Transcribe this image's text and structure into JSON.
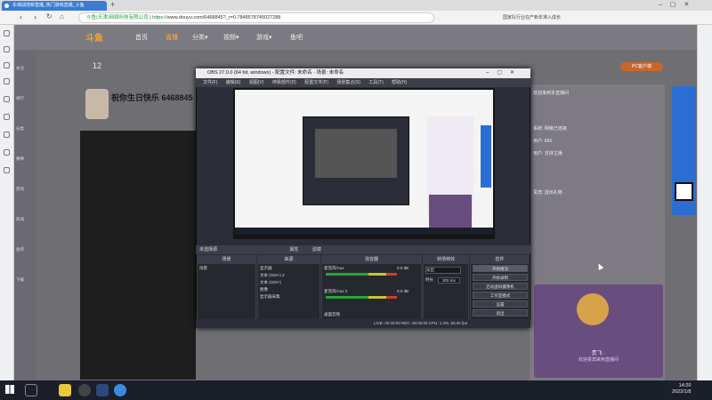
{
  "browser": {
    "tab_title": "东城战境新直播_热门游戏直播_斗鱼",
    "url_org": "斗鱼(天津)网络科技有限公司",
    "url_secure": "https://",
    "url_path": "www.douyu.com/6468845?_r=0.7848578745027288",
    "right_hint": "国家队行业在产新年准入成长"
  },
  "site": {
    "logo": "斗鱼",
    "nav": [
      "首页",
      "直播",
      "分类▾",
      "视频▾",
      "游戏▾",
      "鱼吧"
    ],
    "left_nav": [
      "关注",
      "排行",
      "分类",
      "赛事",
      "游戏",
      "商城",
      "鱼吧",
      "下载"
    ],
    "room_title": "祝你生日快乐 6468845",
    "follow_count": "12",
    "pc_download": "PC客户端"
  },
  "chat": {
    "messages": [
      "欢迎来到本直播间",
      "系统: 网络已连接",
      "用户: 666",
      "用户: 支持主播",
      "贵宾: 送出礼物"
    ],
    "gift_name": "贵飞 ·",
    "gift_sub": "欢迎贵宾来到直播间"
  },
  "obs": {
    "title": "OBS 27.0.0 (64 bit, windows) - 配置文件: 未命名 - 场景: 未命名",
    "menu": [
      "文件(F)",
      "编辑(E)",
      "视图(V)",
      "停靠部件(D)",
      "配置文件(P)",
      "场景集合(S)",
      "工具(T)",
      "帮助(H)"
    ],
    "panel_bar": [
      "未选择源",
      "属性",
      "滤镜"
    ],
    "docks": {
      "scenes": "场景",
      "sources": "来源",
      "mixer": "混音器",
      "transitions": "转场特效",
      "controls": "控件"
    },
    "scene_item": "场景",
    "sources": [
      "显示器",
      "文本 (GDI+) 2",
      "文本 (GDI+)",
      "图像",
      "显示器采集"
    ],
    "mixer": [
      {
        "name": "麦克风/Aux",
        "db": "0.0 dB"
      },
      {
        "name": "麦克风/Aux 2",
        "db": "0.0 dB"
      },
      {
        "name": "桌面音频",
        "db": "0.0 dB"
      }
    ],
    "transition": {
      "type": "淡出",
      "duration_label": "时长",
      "duration": "300 ms"
    },
    "controls": [
      "开始推流",
      "开始录制",
      "启动虚拟摄像机",
      "工作室模式",
      "设置",
      "退出"
    ],
    "status": "LIVE: 00:00:00   REC: 00:00:00   CPU: 1.3%, 60.00 fps"
  },
  "taskbar": {
    "time": "14:20",
    "date": "2022/1/8"
  }
}
